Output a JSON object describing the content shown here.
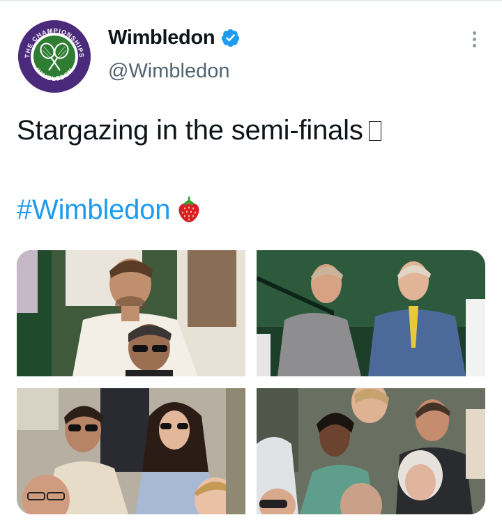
{
  "tweet": {
    "author": {
      "display_name": "Wimbledon",
      "handle": "@Wimbledon",
      "verified": true,
      "avatar_icon": "wimbledon-crest-icon",
      "avatar_text_top": "THE CHAMPIONSHIPS",
      "avatar_text_bottom": "WIMBLEDON"
    },
    "text": "Stargazing in the semi-finals",
    "text_emoji_placeholder": "▯",
    "hashtag": "#Wimbledon",
    "hashtag_emoji": "strawberry-icon",
    "media": [
      {
        "name": "photo-1"
      },
      {
        "name": "photo-2"
      },
      {
        "name": "photo-3"
      },
      {
        "name": "photo-4"
      }
    ]
  },
  "colors": {
    "link": "#1d9bf0",
    "verified": "#1d9bf0",
    "secondary_text": "#536471",
    "brand_purple": "#4b2a7b",
    "brand_green": "#2e7d32"
  }
}
